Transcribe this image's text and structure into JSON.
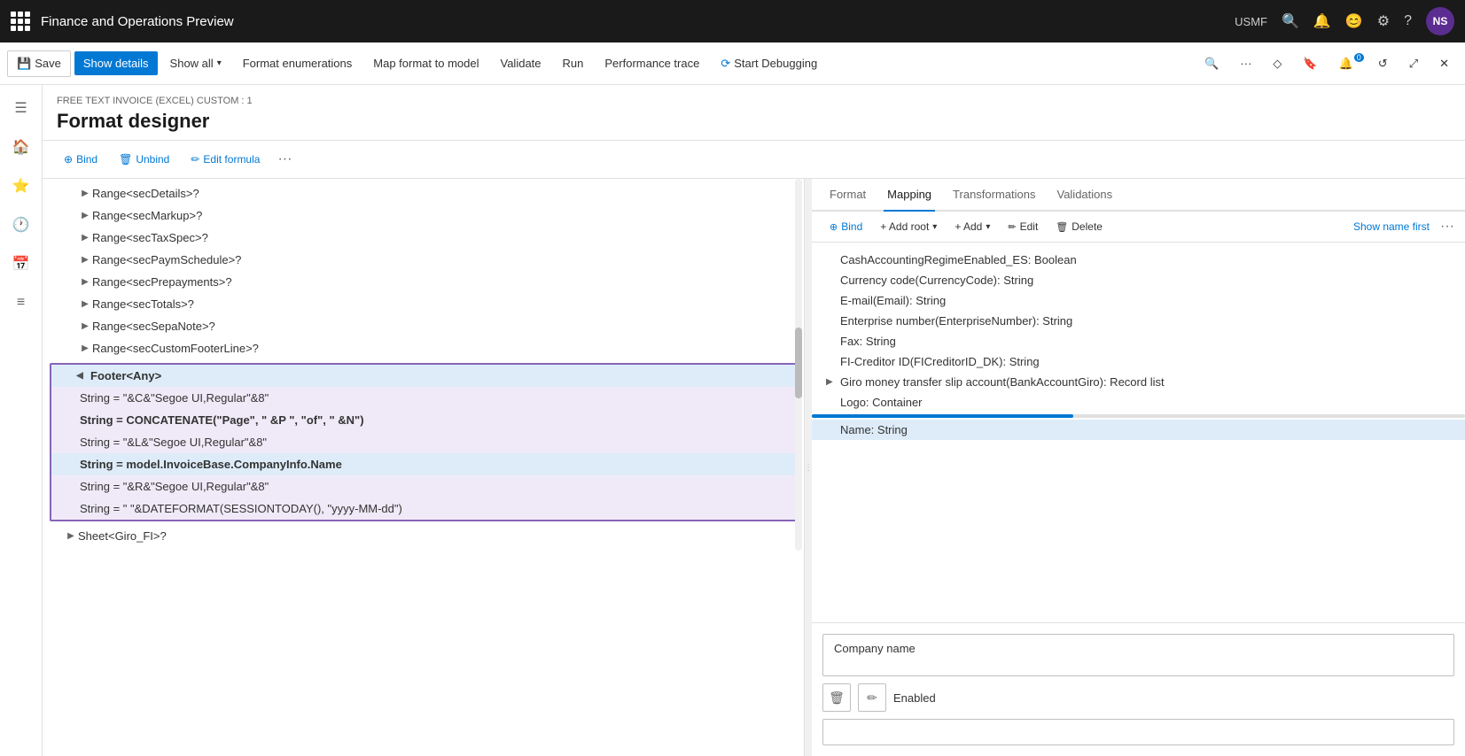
{
  "app": {
    "name": "Finance and Operations Preview",
    "env": "USMF",
    "avatar": "NS"
  },
  "toolbar": {
    "save_label": "Save",
    "show_details_label": "Show details",
    "show_all_label": "Show all",
    "format_enumerations_label": "Format enumerations",
    "map_format_label": "Map format to model",
    "validate_label": "Validate",
    "run_label": "Run",
    "performance_trace_label": "Performance trace",
    "start_debugging_label": "Start Debugging"
  },
  "page": {
    "breadcrumb": "FREE TEXT INVOICE (EXCEL) CUSTOM : 1",
    "title": "Format designer"
  },
  "sub_toolbar": {
    "bind_label": "Bind",
    "unbind_label": "Unbind",
    "edit_formula_label": "Edit formula"
  },
  "tree": {
    "items": [
      {
        "label": "Range<secDetails>?",
        "level": 2,
        "has_children": true,
        "expanded": false
      },
      {
        "label": "Range<secMarkup>?",
        "level": 2,
        "has_children": true,
        "expanded": false
      },
      {
        "label": "Range<secTaxSpec>?",
        "level": 2,
        "has_children": true,
        "expanded": false
      },
      {
        "label": "Range<secPaymSchedule>?",
        "level": 2,
        "has_children": true,
        "expanded": false
      },
      {
        "label": "Range<secPrepayments>?",
        "level": 2,
        "has_children": true,
        "expanded": false
      },
      {
        "label": "Range<secTotals>?",
        "level": 2,
        "has_children": true,
        "expanded": false
      },
      {
        "label": "Range<secSepaNote>?",
        "level": 2,
        "has_children": true,
        "expanded": false
      },
      {
        "label": "Range<secCustomFooterLine>?",
        "level": 2,
        "has_children": true,
        "expanded": false
      }
    ],
    "footer": {
      "label": "Footer<Any>",
      "expanded": true,
      "children": [
        {
          "label": "String = \"&C&\"Segoe UI,Regular\"&8\"",
          "bold": false
        },
        {
          "label": "String = CONCATENATE(\"Page\", \" &P \", \"of\", \" &N\")",
          "bold": true
        },
        {
          "label": "String = \"&L&\"Segoe UI,Regular\"&8\"",
          "bold": false
        },
        {
          "label": "String = model.InvoiceBase.CompanyInfo.Name",
          "bold": true,
          "selected": true
        },
        {
          "label": "String = \"&R&\"Segoe UI,Regular\"&8\"",
          "bold": false
        },
        {
          "label": "String = \" \"&DATEFORMAT(SESSIONTODAY(), \"yyyy-MM-dd\")",
          "bold": false
        }
      ]
    },
    "sheet": {
      "label": "Sheet<Giro_FI>?",
      "level": 1,
      "has_children": true
    }
  },
  "right_panel": {
    "tabs": [
      "Format",
      "Mapping",
      "Transformations",
      "Validations"
    ],
    "active_tab": "Mapping",
    "toolbar": {
      "bind_label": "Bind",
      "add_root_label": "+ Add root",
      "add_label": "+ Add",
      "edit_label": "Edit",
      "delete_label": "Delete",
      "show_name_first_label": "Show name first"
    },
    "model_items": [
      {
        "label": "CashAccountingRegimeEnabled_ES: Boolean",
        "has_children": false
      },
      {
        "label": "Currency code(CurrencyCode): String",
        "has_children": false
      },
      {
        "label": "E-mail(Email): String",
        "has_children": false
      },
      {
        "label": "Enterprise number(EnterpriseNumber): String",
        "has_children": false
      },
      {
        "label": "Fax: String",
        "has_children": false
      },
      {
        "label": "FI-Creditor ID(FICreditorID_DK): String",
        "has_children": false
      },
      {
        "label": "Giro money transfer slip account(BankAccountGiro): Record list",
        "has_children": true,
        "expanded": false
      },
      {
        "label": "Logo: Container",
        "has_children": false
      },
      {
        "label": "Name: String",
        "has_children": false,
        "selected": true
      }
    ],
    "bottom": {
      "company_name_label": "Company name",
      "enabled_label": "Enabled"
    }
  }
}
